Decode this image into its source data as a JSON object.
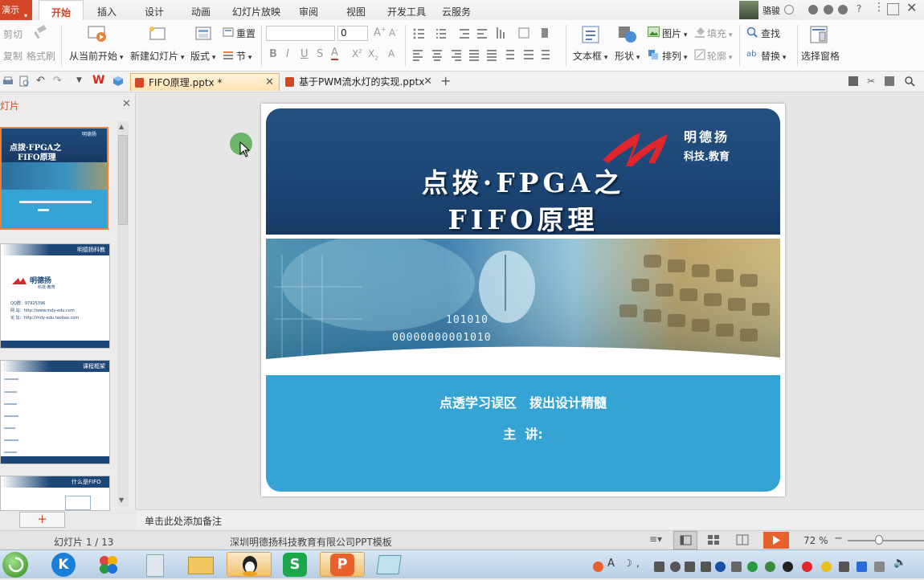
{
  "app": {
    "button_label": "演示"
  },
  "ribbon_tabs": [
    "开始",
    "插入",
    "设计",
    "动画",
    "幻灯片放映",
    "审阅",
    "视图",
    "开发工具",
    "云服务"
  ],
  "user": {
    "name": "骆骏"
  },
  "window_controls": {
    "help": "?"
  },
  "ribbon": {
    "cut": "剪切",
    "copy": "复制",
    "format_painter": "格式刷",
    "from_current": "从当前开始",
    "new_slide": "新建幻灯片",
    "layout": "版式",
    "section": "节",
    "reset": "重置",
    "font_size": "0",
    "textbox": "文本框",
    "shape": "形状",
    "picture": "图片",
    "fill": "填充",
    "arrange": "排列",
    "outline": "轮廓",
    "find": "查找",
    "replace": "替换",
    "selection_pane": "选择窗格"
  },
  "doc_tabs": [
    {
      "title": "FIFO原理.pptx *",
      "active": true
    },
    {
      "title": "基于PWM流水灯的实现.pptx",
      "active": false
    }
  ],
  "left_panel": {
    "title": "灯片",
    "add_label": "+"
  },
  "thumbnails": {
    "t1_title1": "点拨·FPGA之",
    "t1_title2": "FIFO原理",
    "t1_brand": "明德扬",
    "t2_header": "明德扬科教",
    "t2_brand": "明德扬",
    "t2_sub": "科技·教育",
    "t2_qq": "QQ群：97925396",
    "t2_site": "网 站：http://www.mdy-edu.com",
    "t2_forum": "论 坛：http://mdy-edu.taobao.com",
    "t3_header": "课程框架",
    "t4_header": "什么是FIFO"
  },
  "slide": {
    "brand_name": "明德扬",
    "brand_sub": "科技.教育",
    "title_line1": "点拨·FPGA之",
    "title_line2": "FIFO原理",
    "binary1": "101010",
    "binary2": "00000000001010",
    "subtitle": "点透学习误区　拨出设计精髓",
    "speaker": "主  讲:"
  },
  "notes_placeholder": "单击此处添加备注",
  "status": {
    "slide_counter": "幻灯片 1 / 13",
    "template": "深圳明德扬科技教育有限公司PPT模板",
    "zoom": "72 %",
    "zoom_level": 0.72
  },
  "colors": {
    "accent": "#d24726",
    "slide_navy": "#1d4777",
    "slide_blue": "#35a3d3"
  }
}
